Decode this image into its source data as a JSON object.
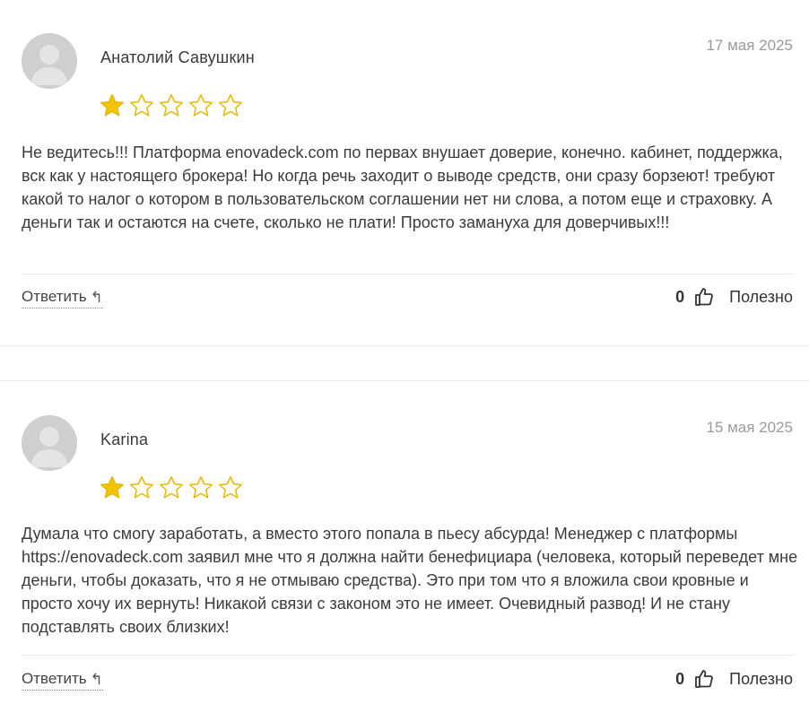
{
  "reviews": [
    {
      "author": "Анатолий Савушкин",
      "date": "17 мая 2025",
      "rating": 1,
      "max_rating": 5,
      "text": "Не ведитесь!!! Платформа enovadeck.com по первах внушает доверие, конечно. кабинет, поддержка, вск как у настоящего брокера! Но когда речь заходит о выводе средств, они сразу борзеют! требуют какой то налог о котором в пользовательском соглашении нет ни слова, а потом еще и страховку. А деньги так и остаются на счете, сколько не плати! Просто замануха для доверчивых!!!",
      "reply_label": "Ответить",
      "reply_icon": "↰",
      "helpful_count": "0",
      "helpful_label": "Полезно"
    },
    {
      "author": "Karina",
      "date": "15 мая 2025",
      "rating": 1,
      "max_rating": 5,
      "text": "Думала что смогу заработать, а вместо этого попала в пьесу абсурда! Менеджер с платформы https://enovadeck.com заявил мне что я должна найти бенефициара (человека, который переведет мне деньги, чтобы доказать, что я не отмываю средства). Это при том что я вложила свои кровные и просто хочу их вернуть! Никакой связи с законом это не имеет. Очевидный развод! И не стану подставлять своих близких!",
      "reply_label": "Ответить",
      "reply_icon": "↰",
      "helpful_count": "0",
      "helpful_label": "Полезно"
    }
  ],
  "colors": {
    "star_filled": "#F2C300",
    "star_outline": "#E8B800",
    "avatar_bg": "#cfcfcf",
    "date_text": "#9a9a9a"
  },
  "icons": {
    "avatar": "default-user-avatar-icon",
    "star": "star-icon",
    "reply": "reply-arrow-icon",
    "like": "thumbs-up-icon"
  }
}
